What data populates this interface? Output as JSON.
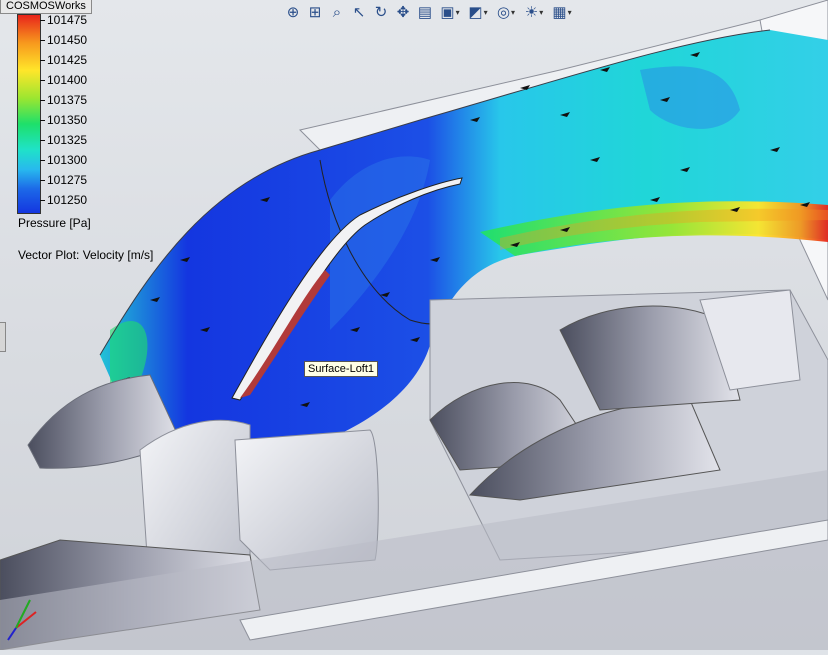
{
  "tab": {
    "label": "COSMOSWorks"
  },
  "legend": {
    "values": [
      "101475",
      "101450",
      "101425",
      "101400",
      "101375",
      "101350",
      "101325",
      "101300",
      "101275",
      "101250"
    ],
    "title": "Pressure [Pa]",
    "gradient": [
      "#e8241b",
      "#f7981d",
      "#ffe62a",
      "#9ce630",
      "#1ee06a",
      "#1fe2c8",
      "#28b9ee",
      "#1c68e8",
      "#1436e0"
    ]
  },
  "vector_plot": {
    "label": "Vector Plot: Velocity [m/s]"
  },
  "tooltip": {
    "text": "Surface-Loft1"
  },
  "toolbar": {
    "icons": [
      "zoom-to-fit-icon",
      "zoom-to-area-icon",
      "zoom-in-out-icon",
      "select-icon",
      "rotate-icon",
      "pan-icon",
      "section-view-icon",
      "view-orientation-icon",
      "display-style-icon",
      "hide-show-icon",
      "lights-icon",
      "scene-icon"
    ]
  },
  "colors": {
    "flow_blue": "#1436e0",
    "flow_cyan": "#26d8e6",
    "flow_green": "#1ee06a",
    "flow_red": "#e8241b",
    "metal": "#d9dbe3"
  }
}
